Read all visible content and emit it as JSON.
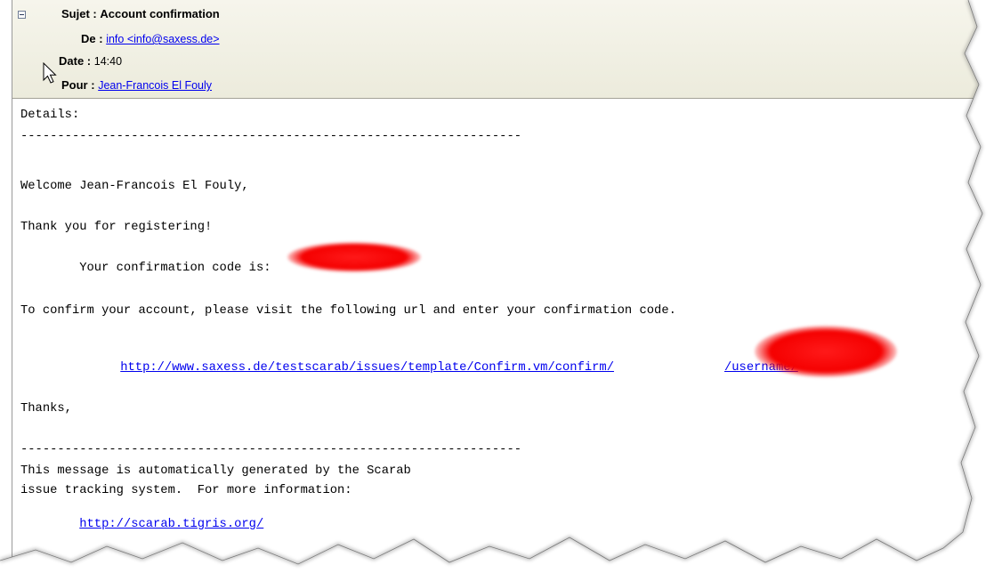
{
  "header": {
    "subject_label": "Sujet :",
    "subject_value": "Account confirmation",
    "from_label": "De :",
    "from_value": "info <info@saxess.de>",
    "date_label": "Date :",
    "date_value": "14:40",
    "to_label": "Pour :",
    "to_value": "Jean-Francois El Fouly"
  },
  "body": {
    "details": "Details:",
    "separator": "--------------------------------------------------------------------",
    "welcome": "Welcome Jean-Francois El Fouly,",
    "thanks_register": "Thank you for registering!",
    "code_label": "Your confirmation code is:",
    "confirm_instruction": "To confirm your account, please visit the following url and enter your confirmation code.",
    "confirm_url_part1": "http://www.saxess.de/testscarab/issues/template/Confirm.vm/confirm/",
    "confirm_url_part2": "/username/",
    "thanks": "Thanks,",
    "footer_line1": "This message is automatically generated by the Scarab",
    "footer_line2": "issue tracking system.  For more information:",
    "footer_link": "http://scarab.tigris.org/"
  }
}
